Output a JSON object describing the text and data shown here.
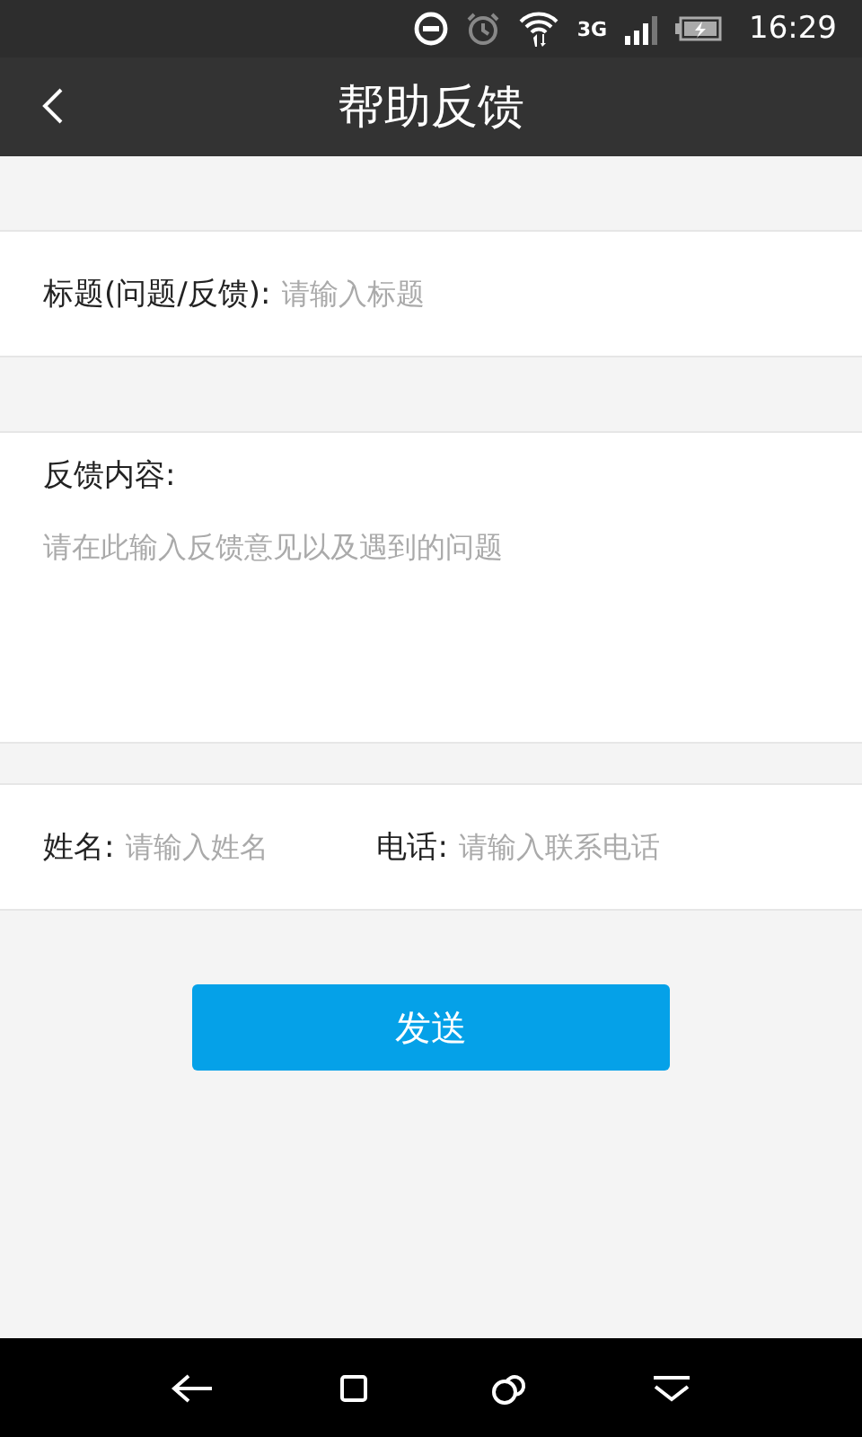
{
  "status_bar": {
    "network": "3G",
    "time": "16:29"
  },
  "header": {
    "title": "帮助反馈"
  },
  "title_field": {
    "label": "标题(问题/反馈):",
    "placeholder": "请输入标题"
  },
  "content_field": {
    "label": "反馈内容:",
    "placeholder": "请在此输入反馈意见以及遇到的问题"
  },
  "name_field": {
    "label": "姓名:",
    "placeholder": "请输入姓名"
  },
  "phone_field": {
    "label": "电话:",
    "placeholder": "请输入联系电话"
  },
  "submit_button": {
    "label": "发送"
  }
}
